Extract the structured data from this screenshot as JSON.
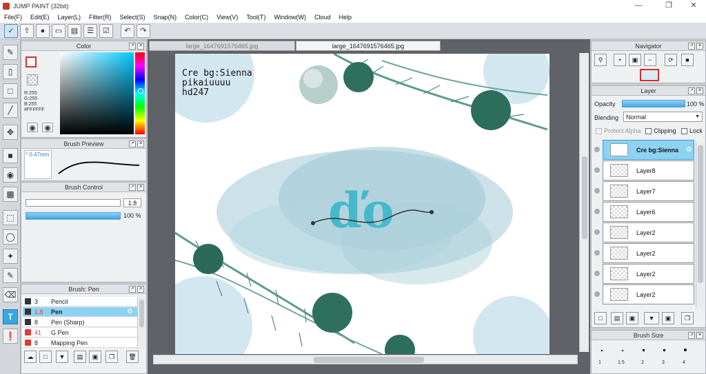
{
  "app": {
    "title": "JUMP PAINT (32bit)"
  },
  "menu": [
    "File(F)",
    "Edit(E)",
    "Layer(L)",
    "Filter(R)",
    "Select(S)",
    "Snap(N)",
    "Color(C)",
    "View(V)",
    "Tool(T)",
    "Window(W)",
    "Cloud",
    "Help"
  ],
  "panels": {
    "color": {
      "title": "Color",
      "r": "R:255",
      "g": "G:255",
      "b": "B:255",
      "hex": "#FFFFFF",
      "hue_colors": "#ff0000,#ff00ff,#0000ff,#00ffff,#00ff00,#ffff00,#ff0000"
    },
    "brush_preview": {
      "title": "Brush Preview",
      "size_label": "0.47mm"
    },
    "brush_control": {
      "title": "Brush Control",
      "size_value": "1.8",
      "opacity_value": "100 %"
    },
    "brush_list": {
      "title": "Brush: Pen",
      "items": [
        {
          "size": "3",
          "name": "Pencil",
          "color": "#333333"
        },
        {
          "size": "1.8",
          "name": "Pen",
          "color": "#333333",
          "selected": true
        },
        {
          "size": "8",
          "name": "Pen (Sharp)",
          "color": "#333333"
        },
        {
          "size": "41",
          "name": "G Pen",
          "color": "#e53935"
        },
        {
          "size": "8",
          "name": "Mapping Pen",
          "color": "#e53935"
        }
      ]
    },
    "navigator": {
      "title": "Navigator"
    },
    "layer": {
      "title": "Layer",
      "opacity_label": "Opacity",
      "opacity_value": "100 %",
      "blending_label": "Blending",
      "blending_value": "Normal",
      "protect_alpha": "Protect Alpha",
      "clipping": "Clipping",
      "lock": "Lock",
      "layers": [
        {
          "name": "Cre bg:Sienna",
          "selected": true
        },
        {
          "name": "Layer8"
        },
        {
          "name": "Layer7"
        },
        {
          "name": "Layer6"
        },
        {
          "name": "Layer2"
        },
        {
          "name": "Layer2"
        },
        {
          "name": "Layer2"
        },
        {
          "name": "Layer2"
        }
      ]
    },
    "brush_size": {
      "title": "Brush Size",
      "labels": [
        "1",
        "1.5",
        "2",
        "3",
        "4"
      ]
    }
  },
  "document": {
    "tabs": [
      "large_1647691576465.jpg",
      "large_1647691576465.jpg"
    ],
    "active_tab": 1,
    "art_text": [
      "Cre bg:Sienna",
      "pikaiuuuu",
      "hd247"
    ]
  }
}
